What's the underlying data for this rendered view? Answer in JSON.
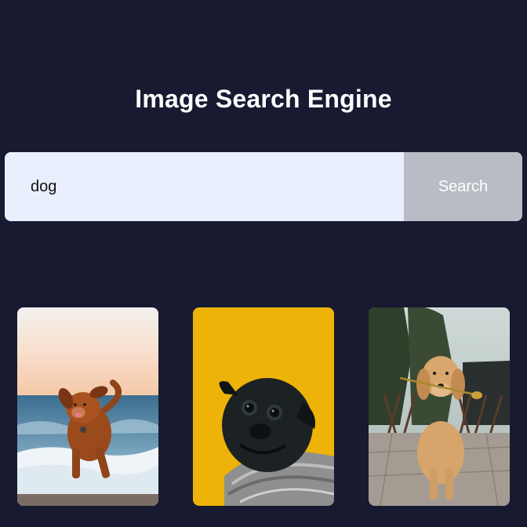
{
  "header": {
    "title": "Image Search Engine"
  },
  "search": {
    "query": "dog",
    "button_label": "Search"
  },
  "results": [
    {
      "subject": "dog running on beach"
    },
    {
      "subject": "black pug in knit sweater"
    },
    {
      "subject": "golden retriever holding flower"
    }
  ]
}
